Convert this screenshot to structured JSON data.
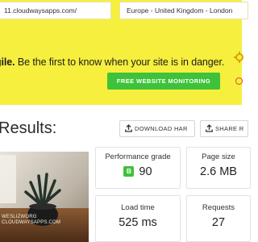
{
  "form": {
    "url_value": "11.cloudwaysapps.com/",
    "location_value": "Europe - United Kingdom - London"
  },
  "promo": {
    "bold_text": "gile.",
    "text": " Be the first to know when your site is in danger.",
    "button_label": "FREE WEBSITE MONITORING"
  },
  "results": {
    "title": "Results:",
    "download_label": "DOWNLOAD HAR",
    "share_label": "SHARE R"
  },
  "thumbnail": {
    "caption_line1": "WESLIZWORG",
    "caption_line2": "CLOUDWAYSAPPS.COM"
  },
  "metrics": [
    {
      "label": "Performance grade",
      "grade": "B",
      "value": "90"
    },
    {
      "label": "Page size",
      "value": "2.6 MB"
    },
    {
      "label": "Load time",
      "value": "525 ms"
    },
    {
      "label": "Requests",
      "value": "27"
    }
  ],
  "colors": {
    "banner": "#f6ef3d",
    "accent_green": "#3ec23b",
    "danger_red": "#e0443b"
  },
  "icons": [
    "gear-icon",
    "radio-icon",
    "upload-icon",
    "share-icon"
  ]
}
